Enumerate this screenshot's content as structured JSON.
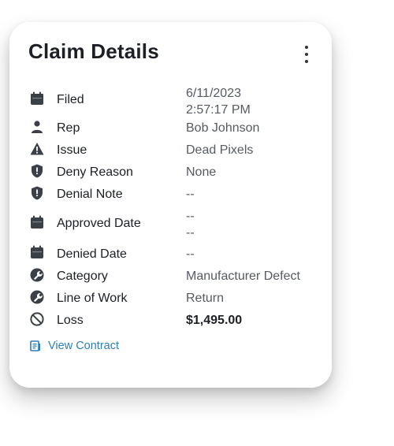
{
  "card": {
    "title": "Claim Details",
    "menu_icon": "more-vertical-icon"
  },
  "rows": [
    {
      "icon": "calendar-icon",
      "label": "Filed",
      "value_lines": [
        "6/11/2023",
        "2:57:17 PM"
      ]
    },
    {
      "icon": "person-icon",
      "label": "Rep",
      "value": "Bob Johnson"
    },
    {
      "icon": "warning-icon",
      "label": "Issue",
      "value": "Dead Pixels"
    },
    {
      "icon": "shield-alert-icon",
      "label": "Deny Reason",
      "value": "None"
    },
    {
      "icon": "shield-alert-icon",
      "label": "Denial Note",
      "value": "--"
    },
    {
      "icon": "calendar-icon",
      "label": "Approved Date",
      "value_lines": [
        "--",
        "--"
      ]
    },
    {
      "icon": "calendar-icon",
      "label": "Denied Date",
      "value": "--"
    },
    {
      "icon": "wrench-icon",
      "label": "Category",
      "value": "Manufacturer Defect"
    },
    {
      "icon": "wrench-icon",
      "label": "Line of Work",
      "value": "Return"
    },
    {
      "icon": "block-icon",
      "label": "Loss",
      "value": "$1,495.00"
    }
  ],
  "link": {
    "icon": "document-icon",
    "label": "View Contract"
  },
  "colors": {
    "text": "#1c1f26",
    "value": "#555a63",
    "link": "#2e7fb0",
    "icon": "#3a3f48"
  }
}
